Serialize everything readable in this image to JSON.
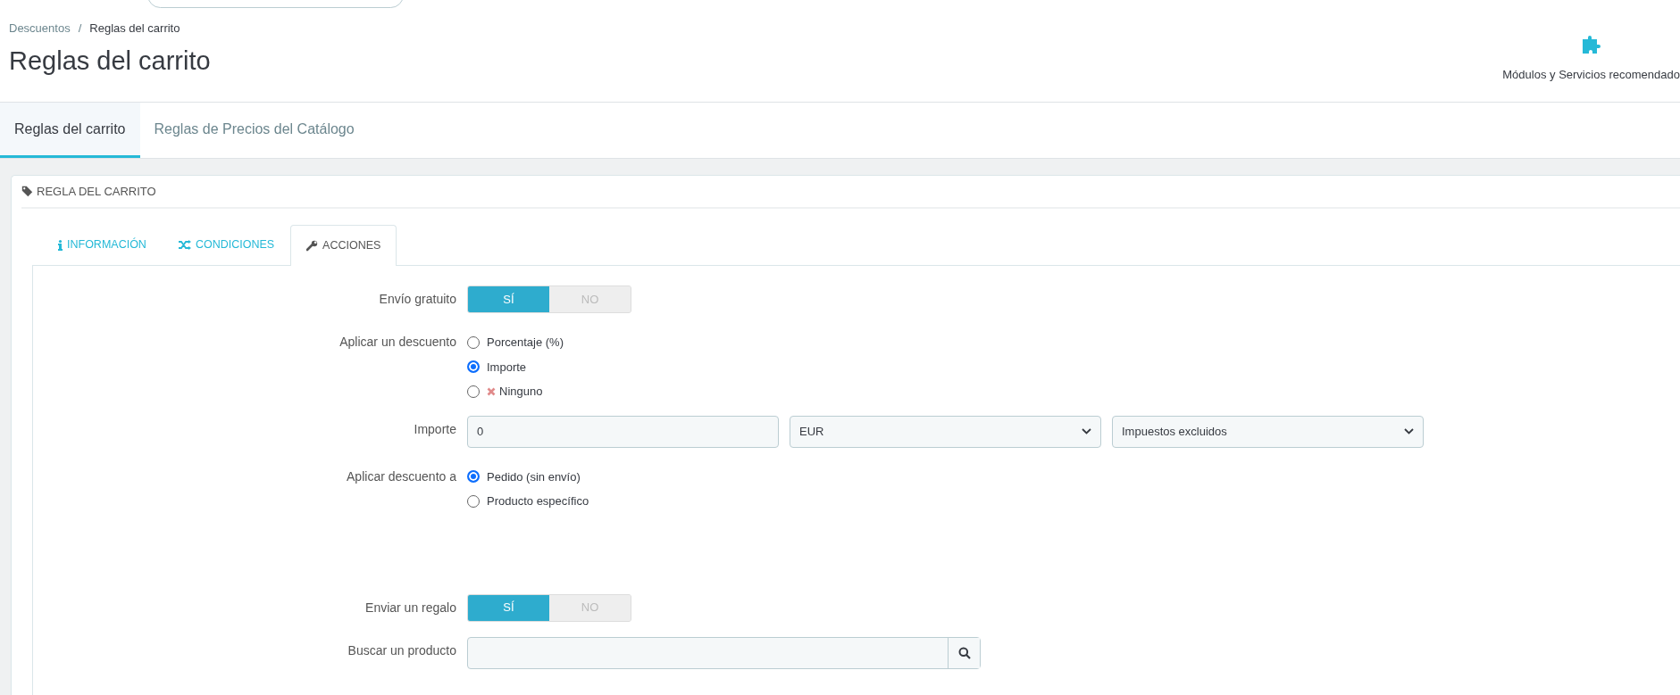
{
  "breadcrumb_separator": "/",
  "breadcrumb": [
    {
      "label": "Descuentos",
      "current": false
    },
    {
      "label": "Reglas del carrito",
      "current": true
    }
  ],
  "page_title": "Reglas del carrito",
  "toolbar_button": {
    "label": "Módulos y Servicios recomendado"
  },
  "page_tabs": [
    {
      "label": "Reglas del carrito",
      "selected": true
    },
    {
      "label": "Reglas de Precios del Catálogo",
      "selected": false
    }
  ],
  "panel": {
    "title": "REGLA DEL CARRITO",
    "tabs": [
      {
        "label": "INFORMACIÓN",
        "kind": "info",
        "selected": false
      },
      {
        "label": "CONDICIONES",
        "kind": "shuffle",
        "selected": false
      },
      {
        "label": "ACCIONES",
        "kind": "wrench",
        "selected": true
      }
    ],
    "rows": [
      {
        "kind": "switch",
        "label": "Envío gratuito",
        "options": [
          {
            "label": "SÍ",
            "selected": true
          },
          {
            "label": "NO",
            "selected": false
          }
        ]
      },
      {
        "kind": "radios",
        "label": "Aplicar un descuento",
        "options": [
          {
            "label": "Porcentaje (%)",
            "kind": "plain",
            "selected": false
          },
          {
            "label": "Importe",
            "kind": "plain",
            "selected": true
          },
          {
            "label": "Ninguno",
            "kind": "cross",
            "selected": false
          }
        ]
      },
      {
        "kind": "amount",
        "label": "Importe",
        "value": "0",
        "currency": "EUR",
        "tax": "Impuestos excluidos"
      },
      {
        "kind": "radios",
        "label": "Aplicar descuento a",
        "options": [
          {
            "label": "Pedido (sin envío)",
            "kind": "plain",
            "selected": true
          },
          {
            "label": "Producto específico",
            "kind": "plain",
            "selected": false
          }
        ]
      },
      {
        "kind": "spacer"
      },
      {
        "kind": "switch",
        "label": "Enviar un regalo",
        "options": [
          {
            "label": "SÍ",
            "selected": true
          },
          {
            "label": "NO",
            "selected": false
          }
        ]
      },
      {
        "kind": "search",
        "label": "Buscar un producto"
      }
    ]
  }
}
